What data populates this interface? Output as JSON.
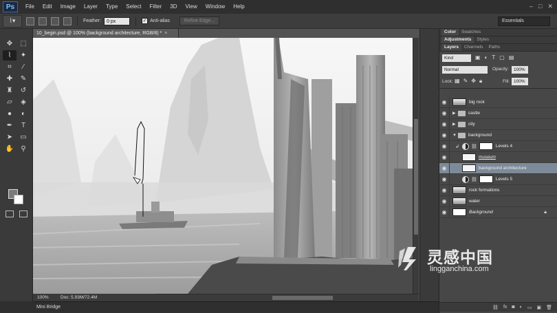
{
  "app": {
    "logo": "Ps",
    "menu": [
      "File",
      "Edit",
      "Image",
      "Layer",
      "Type",
      "Select",
      "Filter",
      "3D",
      "View",
      "Window",
      "Help"
    ]
  },
  "options": {
    "feather_label": "Feather:",
    "feather_value": "0 px",
    "anti_alias_label": "Anti-alias",
    "anti_alias_checked": "✓",
    "refine_edge": "Refine Edge...",
    "workspace": "Essentials"
  },
  "document": {
    "tab_title": "10_begin.psd @ 100% (background architecture, RGB/8) *",
    "close": "×",
    "zoom": "100%",
    "doc_size": "Doc: 5.93M/72.4M"
  },
  "mini_bridge": "Mini Bridge",
  "panels": {
    "top_tabs": [
      "Color",
      "Swatches"
    ],
    "mid_tabs": [
      "Adjustments",
      "Styles"
    ],
    "layer_tabs": [
      "Layers",
      "Channels",
      "Paths"
    ],
    "kind": "Kind",
    "blend_mode": "Normal",
    "opacity_label": "Opacity:",
    "opacity_value": "100%",
    "lock_label": "Lock:",
    "fill_label": "Fill:",
    "fill_value": "100%"
  },
  "layers": [
    {
      "name": "big rock",
      "kind": "pixel"
    },
    {
      "name": "castle",
      "kind": "group"
    },
    {
      "name": "city",
      "kind": "group"
    },
    {
      "name": "background",
      "kind": "group-open"
    },
    {
      "name": "Levels 4",
      "kind": "adjustment"
    },
    {
      "name": "museum",
      "kind": "pixel-clip"
    },
    {
      "name": "background architecture",
      "kind": "selected"
    },
    {
      "name": "Levels 5",
      "kind": "adjustment"
    },
    {
      "name": "rock formations",
      "kind": "pixel"
    },
    {
      "name": "water",
      "kind": "pixel"
    },
    {
      "name": "Background",
      "kind": "locked"
    }
  ],
  "watermark": {
    "cn": "灵感中国",
    "en": "lingganchina.com"
  },
  "colors": {
    "chrome_dark": "#2f2f2f",
    "panel": "#474747",
    "selected_layer": "#7d8a99"
  }
}
